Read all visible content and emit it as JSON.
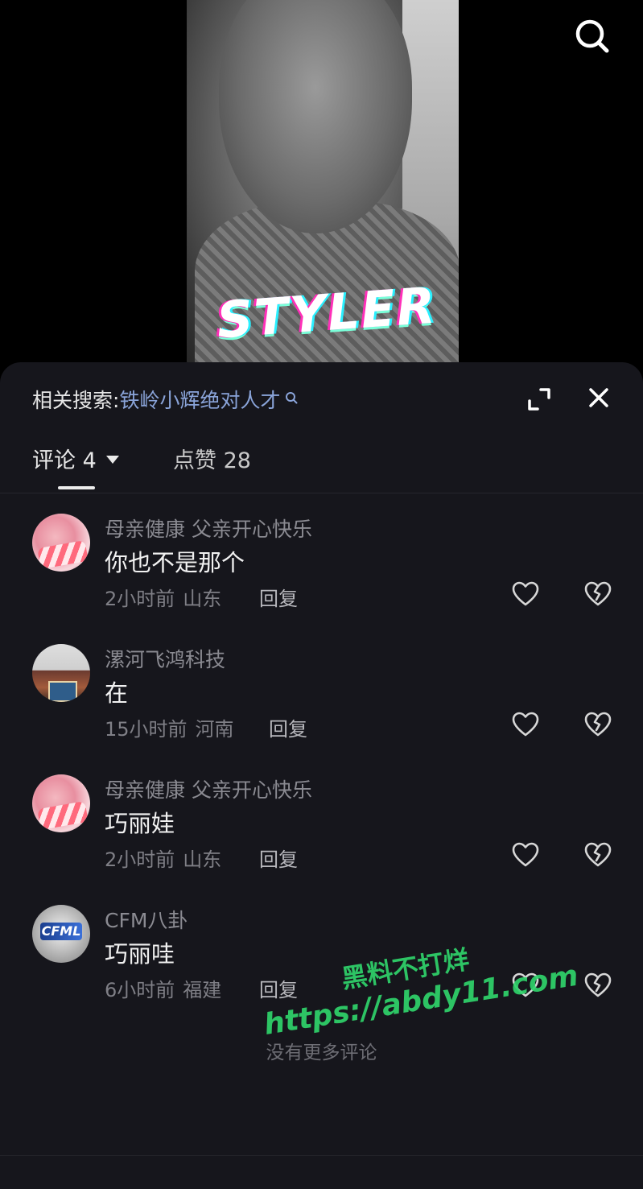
{
  "video": {
    "overlay_text": "STYLER",
    "search_icon": "search-icon"
  },
  "panel": {
    "related_label": "相关搜索:",
    "related_query": "铁岭小辉绝对人才",
    "tabs": {
      "comments_label": "评论 4",
      "likes_label": "点赞 28"
    },
    "icons": {
      "expand": "expand-icon",
      "close": "close-icon"
    }
  },
  "comments": [
    {
      "user": "母亲健康 父亲开心快乐",
      "text": "你也不是那个",
      "time": "2小时前",
      "location": "山东",
      "reply": "回复",
      "avatar": "pink-hands"
    },
    {
      "user": "漯河飞鸿科技",
      "text": "在",
      "time": "15小时前",
      "location": "河南",
      "reply": "回复",
      "avatar": "store-front"
    },
    {
      "user": "母亲健康 父亲开心快乐",
      "text": "巧丽娃",
      "time": "2小时前",
      "location": "山东",
      "reply": "回复",
      "avatar": "pink-hands"
    },
    {
      "user": "CFM八卦",
      "text": "巧丽哇",
      "time": "6小时前",
      "location": "福建",
      "reply": "回复",
      "avatar": "cfm-logo",
      "avatar_text": "CFML"
    }
  ],
  "footer": {
    "no_more": "没有更多评论"
  },
  "watermark": {
    "line1": "黑料不打烊",
    "line2": "https://abdy11.com"
  },
  "colors": {
    "panel_bg": "#16161c",
    "link_blue": "#8aa4d9",
    "watermark_green": "#2fd36b"
  }
}
